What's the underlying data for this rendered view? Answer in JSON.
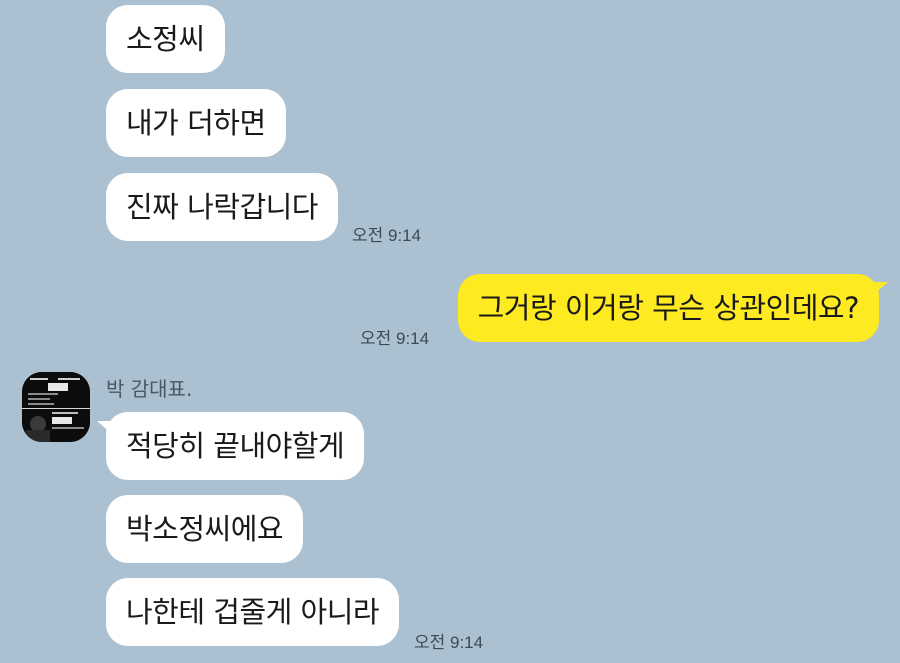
{
  "messages": [
    {
      "text": "소정씨"
    },
    {
      "text": "내가 더하면"
    },
    {
      "text": "진짜 나락갑니다"
    },
    {
      "text": "그거랑 이거랑 무슨 상관인데요?"
    },
    {
      "text": "적당히 끝내야할게"
    },
    {
      "text": "박소정씨에요"
    },
    {
      "text": "나한테 겁줄게 아니라"
    }
  ],
  "timestamps": [
    "오전 9:14",
    "오전 9:14",
    "오전 9:14"
  ],
  "sender": {
    "name": "박   감대표."
  },
  "colors": {
    "background": "#abc1d1",
    "incoming": "#ffffff",
    "outgoing": "#fdea20"
  }
}
